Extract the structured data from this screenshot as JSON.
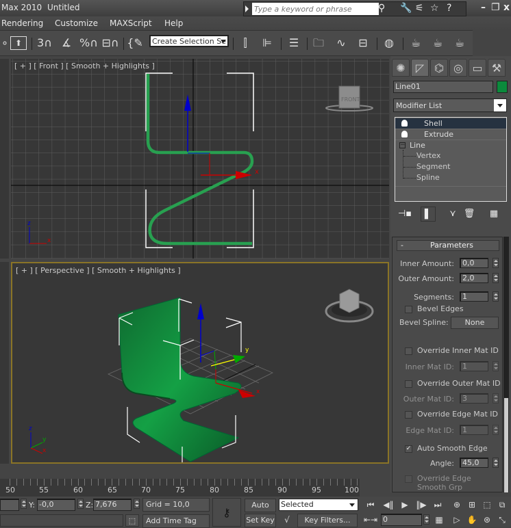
{
  "titlebar": {
    "app": "Max  2010",
    "document": "Untitled",
    "search_placeholder": "Type a keyword or phrase",
    "icons": [
      "binoculars-icon",
      "key-icon",
      "satellite-icon",
      "star-icon",
      "help-icon"
    ],
    "window_buttons": [
      "minimize",
      "restore",
      "close"
    ]
  },
  "menubar": {
    "items": [
      "Rendering",
      "Customize",
      "MAXScript",
      "Help"
    ]
  },
  "toolbar": {
    "selection_set_value": "Create Selection Se",
    "snap_label": "3",
    "percent_label": "%"
  },
  "viewports": {
    "front": {
      "label": "[ + ] [ Front ] [ Smooth + Highlights ]",
      "viewcube_label": "FRONT"
    },
    "perspective": {
      "label": "[ + ] [ Perspective ] [ Smooth + Highlights ]"
    },
    "axis_labels": {
      "x": "x",
      "y": "y",
      "z": "z"
    }
  },
  "command_panel": {
    "tabs": [
      "create",
      "modify",
      "hierarchy",
      "motion",
      "display",
      "utilities"
    ],
    "object_name": "Line01",
    "object_color": "#0b8a3c",
    "modifier_list": "Modifier List",
    "stack": [
      {
        "name": "Shell",
        "selected": true
      },
      {
        "name": "Extrude",
        "selected": false
      },
      {
        "name": "Line",
        "selected": false
      }
    ],
    "sub_objects": [
      "Vertex",
      "Segment",
      "Spline"
    ],
    "parameters": {
      "title": "Parameters",
      "collapse": "-",
      "inner_amount_label": "Inner Amount:",
      "inner_amount": "0,0",
      "outer_amount_label": "Outer Amount:",
      "outer_amount": "2,0",
      "segments_label": "Segments:",
      "segments": "1",
      "bevel_edges_label": "Bevel Edges",
      "bevel_edges": false,
      "bevel_spline_label": "Bevel Spline:",
      "bevel_spline_value": "None",
      "override_inner_label": "Override Inner Mat ID",
      "override_inner": false,
      "inner_mat_id_label": "Inner Mat ID:",
      "inner_mat_id": "1",
      "override_outer_label": "Override Outer Mat ID",
      "override_outer": false,
      "outer_mat_id_label": "Outer Mat ID:",
      "outer_mat_id": "3",
      "override_edge_label": "Override Edge Mat ID",
      "override_edge": false,
      "edge_mat_id_label": "Edge Mat ID:",
      "edge_mat_id": "1",
      "auto_smooth_label": "Auto Smooth Edge",
      "auto_smooth": true,
      "angle_label": "Angle:",
      "angle": "45,0",
      "override_edge_smooth_label": "Override Edge Smooth Grp",
      "override_edge_smooth": false
    }
  },
  "timeline": {
    "labels": [
      "50",
      "55",
      "60",
      "65",
      "70",
      "75",
      "80",
      "85",
      "90",
      "95",
      "100"
    ]
  },
  "statusbar": {
    "y_label": "Y:",
    "y_value": "-0,0",
    "z_label": "Z:",
    "z_value": "7,676",
    "grid": "Grid = 10,0",
    "add_time_tag": "Add Time Tag",
    "auto_key": "Auto Key",
    "set_key": "Set Key",
    "key_mode": "Selected",
    "key_filters": "Key Filters...",
    "current_frame": "0"
  }
}
